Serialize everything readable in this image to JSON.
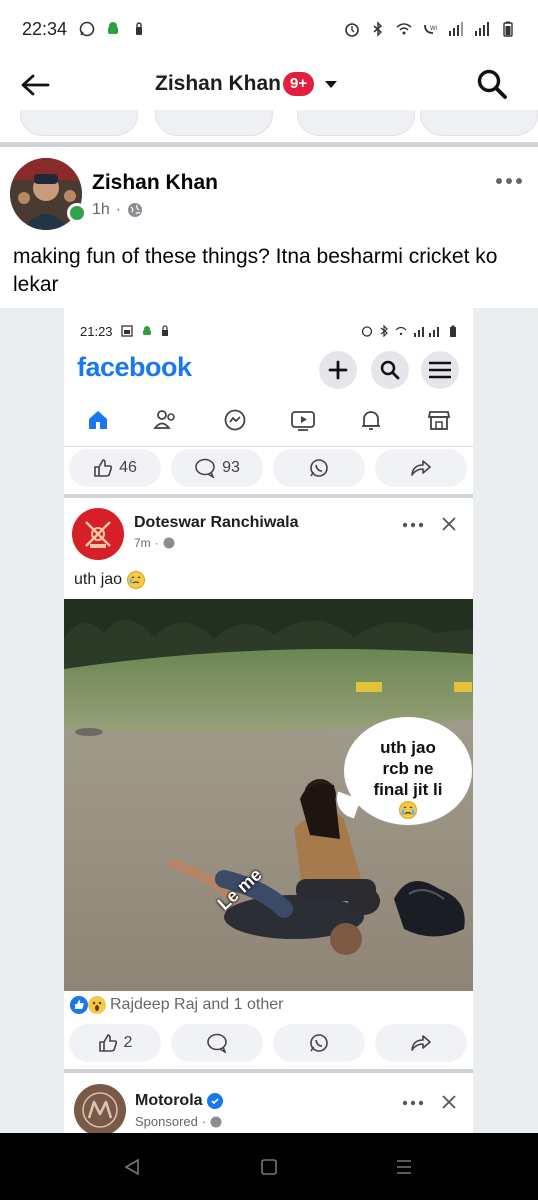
{
  "status_bar": {
    "time": "22:34",
    "left_icons": [
      "whatsapp-icon",
      "android-icon",
      "lock-icon"
    ],
    "right_icons": [
      "alarm-icon",
      "bluetooth-icon",
      "wifi-icon",
      "volte-icon",
      "signal-icon",
      "battery-icon"
    ]
  },
  "header": {
    "title": "Zishan Khan",
    "badge": "9+",
    "back_icon": "back-arrow-icon",
    "search_icon": "search-icon"
  },
  "post": {
    "author": "Zishan Khan",
    "time": "1h",
    "privacy_icon": "globe-icon",
    "text": "making fun of these things? Itna besharmi cricket ko lekar",
    "online": true
  },
  "embedded_screenshot": {
    "status_time": "21:23",
    "brand": "facebook",
    "nav_icons": [
      "home-icon",
      "friends-icon",
      "messenger-icon",
      "video-icon",
      "notifications-icon",
      "marketplace-icon"
    ],
    "top_actions": {
      "likes": "46",
      "comments": "93"
    },
    "post": {
      "author": "Doteswar Ranchiwala",
      "time": "7m",
      "text": "uth jao",
      "meme": {
        "speech_line1": "uth jao",
        "speech_line2": "rcb ne",
        "speech_line3": "final jit li",
        "overlay_label": "Le me"
      },
      "reactions": "Rajdeep Raj and 1 other",
      "likes": "2"
    },
    "ad": {
      "name": "Motorola",
      "sponsored": "Sponsored"
    }
  },
  "colors": {
    "facebook_blue": "#1877f2",
    "badge_red": "#e41e3f",
    "online_green": "#31a24c"
  }
}
